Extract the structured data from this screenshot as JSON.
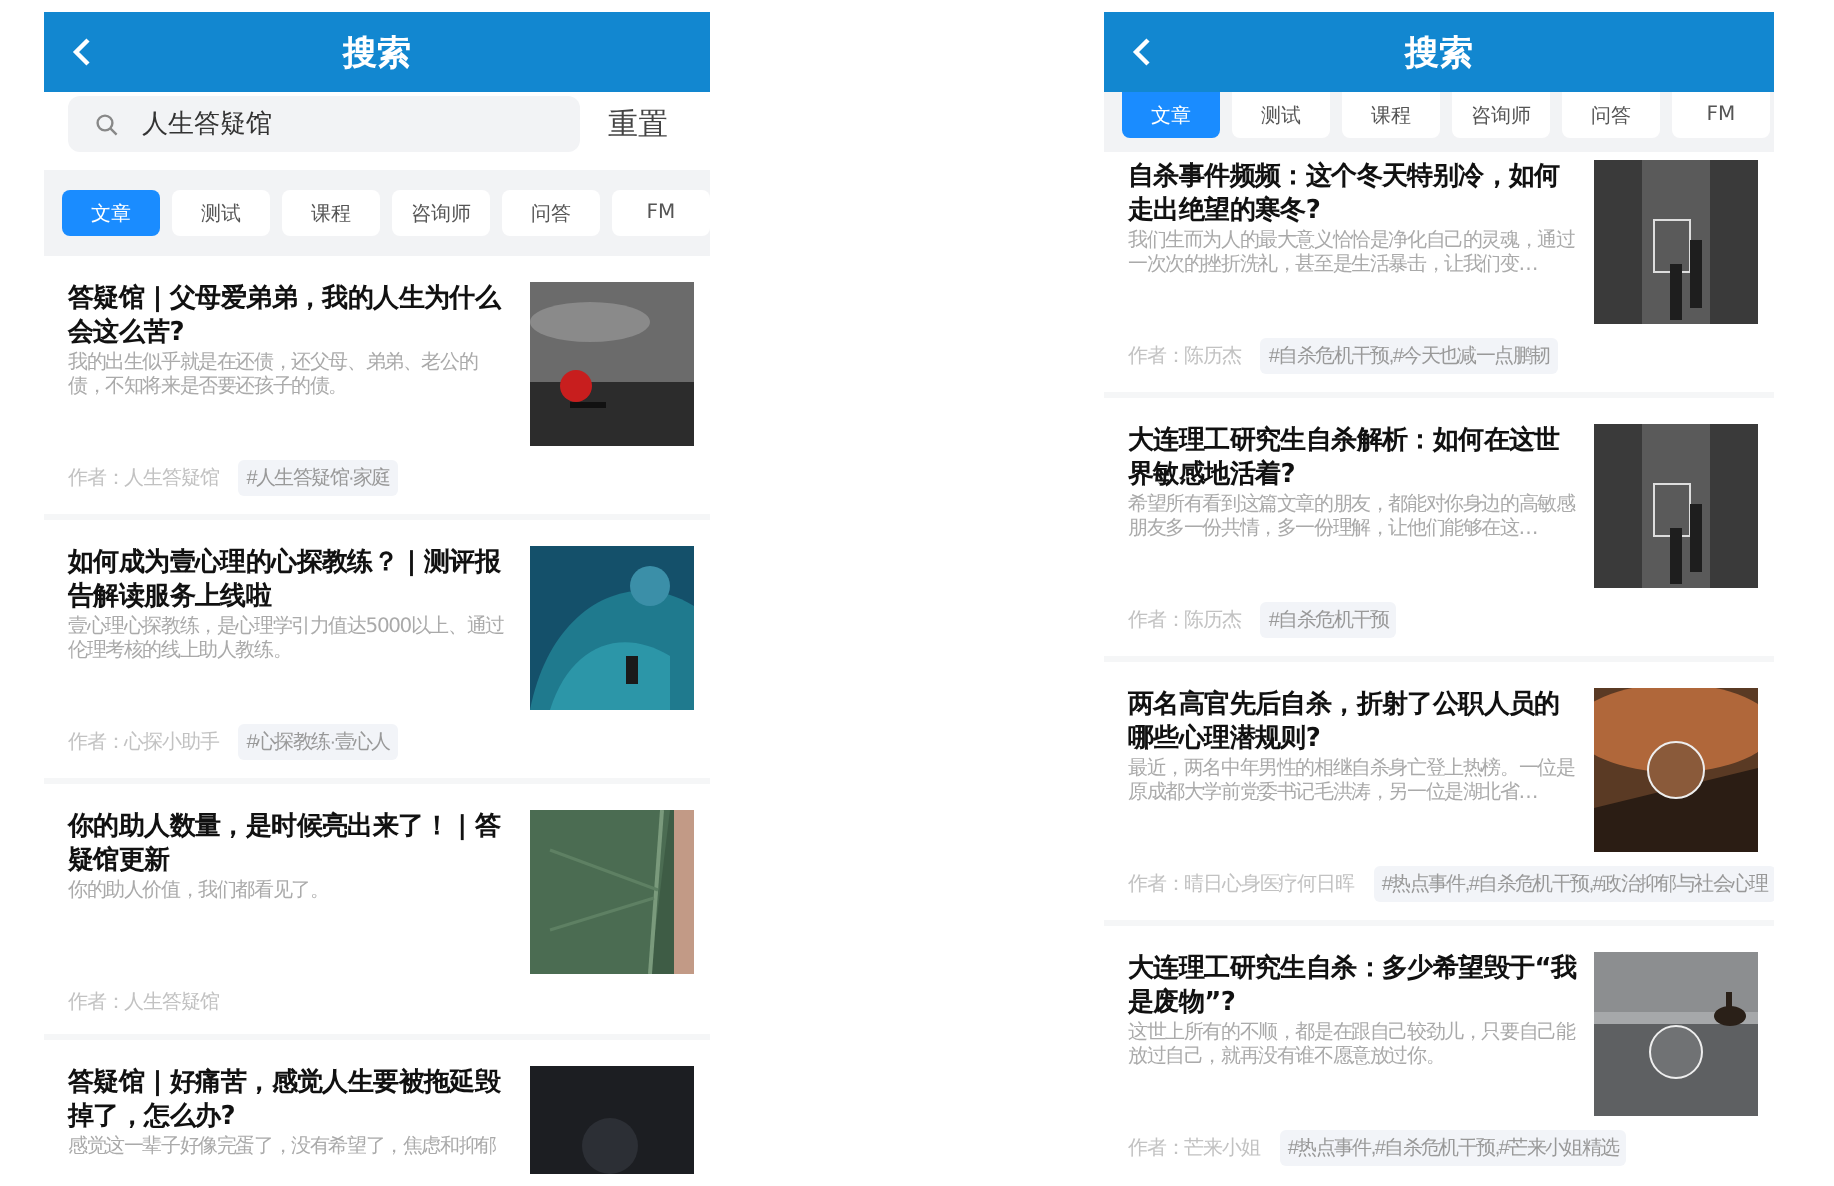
{
  "screens": [
    {
      "header": {
        "title": "搜索"
      },
      "search": {
        "value": "人生答疑馆",
        "reset": "重置"
      },
      "tabs": [
        {
          "label": "文章",
          "selected": true
        },
        {
          "label": "测试",
          "selected": false
        },
        {
          "label": "课程",
          "selected": false
        },
        {
          "label": "咨询师",
          "selected": false
        },
        {
          "label": "问答",
          "selected": false
        },
        {
          "label": "FM",
          "selected": false
        }
      ],
      "articles": [
        {
          "title": "答疑馆 | 父母爱弟弟，我的人生为什么会这么苦?",
          "summary": "我的出生似乎就是在还债，还父母、弟弟、老公的债，不知将来是否要还孩子的债。",
          "author": "作者：人生答疑馆",
          "tag": "#人生答疑馆·家庭"
        },
        {
          "title": "如何成为壹心理的心探教练？ | 测评报告解读服务上线啦",
          "summary": "壹心理心探教练，是心理学引力值达5000以上、通过伦理考核的线上助人教练。",
          "author": "作者：心探小助手",
          "tag": "#心探教练·壹心人"
        },
        {
          "title": "你的助人数量，是时候亮出来了！ | 答疑馆更新",
          "summary": "你的助人价值，我们都看见了。",
          "author": "作者：人生答疑馆"
        },
        {
          "title": "答疑馆 | 好痛苦，感觉人生要被拖延毁掉了，怎么办?",
          "summary": "感觉这一辈子好像完蛋了，没有希望了，焦虑和抑郁"
        }
      ]
    },
    {
      "header": {
        "title": "搜索"
      },
      "tabs": [
        {
          "label": "文章",
          "selected": true
        },
        {
          "label": "测试",
          "selected": false
        },
        {
          "label": "课程",
          "selected": false
        },
        {
          "label": "咨询师",
          "selected": false
        },
        {
          "label": "问答",
          "selected": false
        },
        {
          "label": "FM",
          "selected": false
        }
      ],
      "articles": [
        {
          "title": "自杀事件频频：这个冬天特别冷，如何走出绝望的寒冬?",
          "summary": "我们生而为人的最大意义恰恰是净化自己的灵魂，通过一次次的挫折洗礼，甚至是生活暴击，让我们变…",
          "author": "作者：陈历杰",
          "tag": "#自杀危机干预,#今天也减一点鹏韧"
        },
        {
          "title": "大连理工研究生自杀解析：如何在这世界敏感地活着?",
          "summary": "希望所有看到这篇文章的朋友，都能对你身边的高敏感朋友多一份共情，多一份理解，让他们能够在这…",
          "author": "作者：陈历杰",
          "tag": "#自杀危机干预"
        },
        {
          "title": "两名高官先后自杀，折射了公职人员的哪些心理潜规则?",
          "summary": "最近，两名中年男性的相继自杀身亡登上热榜。一位是原成都大学前党委书记毛洪涛，另一位是湖北省…",
          "author": "作者：晴日心身医疗何日晖",
          "tag": "#热点事件,#自杀危机干预,#政治抑郁与社会心理"
        },
        {
          "title": "大连理工研究生自杀：多少希望毁于“我是废物”?",
          "summary": "这世上所有的不顺，都是在跟自己较劲儿，只要自己能放过自己，就再没有谁不愿意放过你。",
          "author": "作者：芒来小姐",
          "tag": "#热点事件,#自杀危机干预,#芒来小姐精选"
        }
      ]
    }
  ]
}
